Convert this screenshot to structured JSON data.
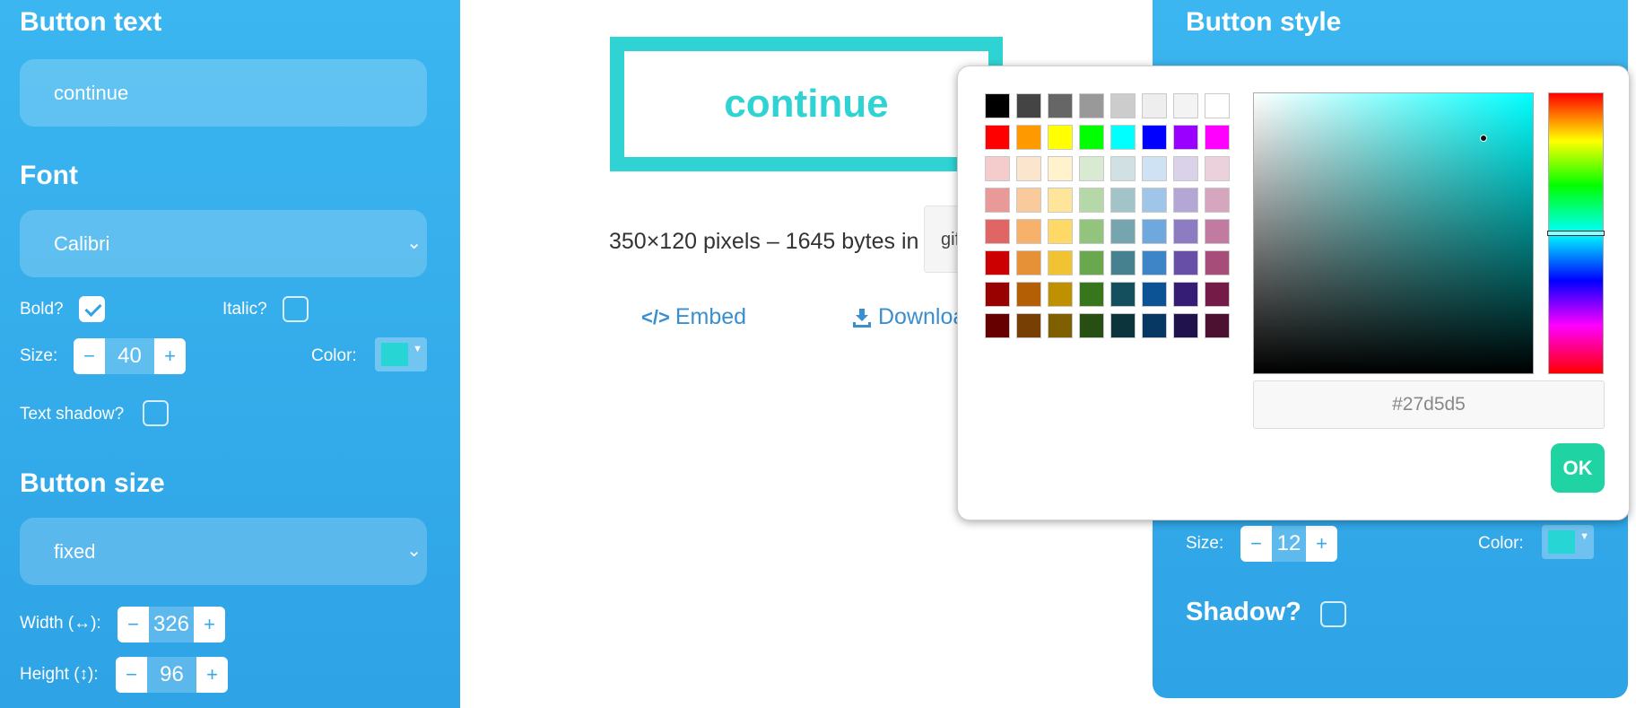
{
  "left_panel": {
    "button_text": {
      "title": "Button text",
      "value": "continue"
    },
    "font": {
      "title": "Font",
      "selected": "Calibri"
    },
    "bold_label": "Bold?",
    "italic_label": "Italic?",
    "size_label": "Size:",
    "size_value": "40",
    "color_label": "Color:",
    "text_color": "#27d5d5",
    "text_shadow_label": "Text shadow?",
    "button_size": {
      "title": "Button size",
      "selected": "fixed"
    },
    "width_label": "Width (↔):",
    "width_value": "326",
    "height_label": "Height (↕):",
    "height_value": "96"
  },
  "preview": {
    "button_label": "continue",
    "info": "350×120 pixels – 1645 bytes in",
    "format": "gif",
    "embed_label": "Embed",
    "download_label": "Downloa"
  },
  "right_panel": {
    "title": "Button style",
    "border_size_label": "Size:",
    "border_size_value": "12",
    "border_color_label": "Color:",
    "border_color": "#27d5d5",
    "shadow_label": "Shadow?"
  },
  "color_picker": {
    "hex_value": "#27d5d5",
    "ok_label": "OK",
    "palette": [
      [
        "#000000",
        "#444444",
        "#666666",
        "#999999",
        "#cccccc",
        "#eeeeee",
        "#f3f3f3",
        "#ffffff"
      ],
      [
        "#ff0000",
        "#ff9900",
        "#ffff00",
        "#00ff00",
        "#00ffff",
        "#0000ff",
        "#9900ff",
        "#ff00ff"
      ],
      [
        "#f4cccc",
        "#fce5cd",
        "#fff2cc",
        "#d9ead3",
        "#d0e0e3",
        "#cfe2f3",
        "#d9d2e9",
        "#ead1dc"
      ],
      [
        "#ea9999",
        "#f9cb9c",
        "#ffe599",
        "#b6d7a8",
        "#a2c4c9",
        "#9fc5e8",
        "#b4a7d6",
        "#d5a6bd"
      ],
      [
        "#e06666",
        "#f6b26b",
        "#ffd966",
        "#93c47d",
        "#76a5af",
        "#6fa8dc",
        "#8e7cc3",
        "#c27ba0"
      ],
      [
        "#cc0000",
        "#e69138",
        "#f1c232",
        "#6aa84f",
        "#45818e",
        "#3d85c6",
        "#674ea7",
        "#a64d79"
      ],
      [
        "#990000",
        "#b45f06",
        "#bf9000",
        "#38761d",
        "#134f5c",
        "#0b5394",
        "#351c75",
        "#741b47"
      ],
      [
        "#660000",
        "#783f04",
        "#7f6000",
        "#274e13",
        "#0c343d",
        "#073763",
        "#20124d",
        "#4c1130"
      ]
    ]
  }
}
